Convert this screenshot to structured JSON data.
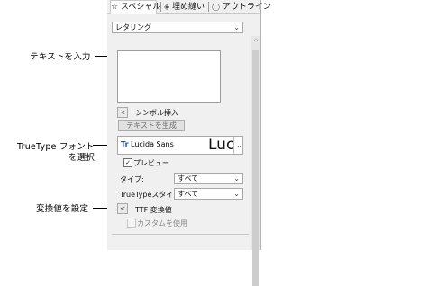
{
  "tabs": [
    {
      "icon": "star-icon",
      "label": "スペシャル"
    },
    {
      "icon": "fill-icon",
      "label": "埋め縫い"
    },
    {
      "icon": "outline-icon",
      "label": "アウトライン"
    }
  ],
  "lettering_type": {
    "value": "レタリング"
  },
  "callouts": {
    "enter_text": "テキストを入力",
    "truetype_line1": "TrueType フォント",
    "truetype_line2": "を選択",
    "set_transform": "変換値を設定"
  },
  "symbol_insert": {
    "button": "<",
    "label": "シンボル挿入"
  },
  "generate_text_button": "テキストを生成",
  "font": {
    "name": "Lucida Sans",
    "preview": "Luc",
    "icon_text": "Tr"
  },
  "preview_checkbox": {
    "label": "プレビュー",
    "checked": true
  },
  "type_field": {
    "label": "タイプ:",
    "value": "すべて"
  },
  "truetype_style": {
    "label": "TrueTypeスタイル:",
    "value": "すべて"
  },
  "ttf_transform": {
    "button": "<",
    "label": "TTF 変換値"
  },
  "use_custom": {
    "label": "カスタムを使用",
    "checked": false
  },
  "scroll_up": "^"
}
